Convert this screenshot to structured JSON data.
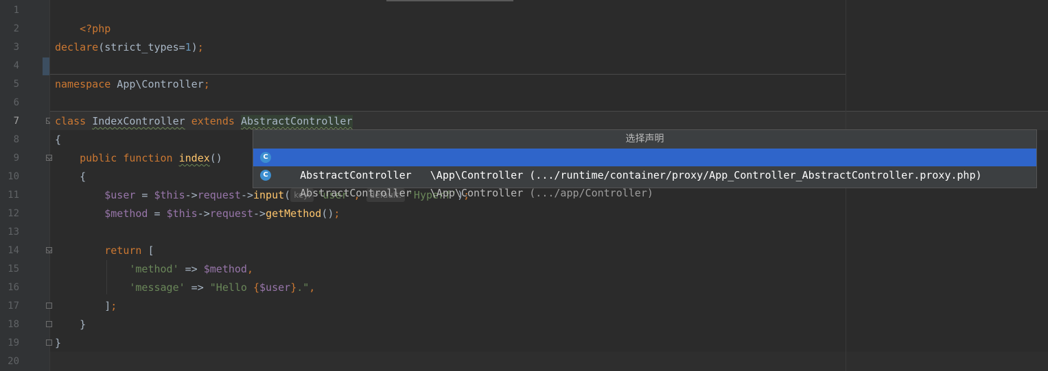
{
  "gutter": {
    "line_numbers": [
      "1",
      "2",
      "3",
      "4",
      "5",
      "6",
      "7",
      "8",
      "9",
      "10",
      "11",
      "12",
      "13",
      "14",
      "15",
      "16",
      "17",
      "18",
      "19",
      "20"
    ]
  },
  "code": {
    "l1": {
      "open_tag": "<?php"
    },
    "l3": {
      "declare": "declare",
      "paren_open": "(",
      "arg": "strict_types=",
      "value": "1",
      "paren_close": ")",
      "semi": ";"
    },
    "l5": {
      "namespace_kw": "namespace",
      "name": " App\\Controller",
      "semi": ";"
    },
    "l7": {
      "class_kw": "class",
      "class_name": "IndexController",
      "extends_kw": "extends",
      "parent": "AbstractController"
    },
    "l8": {
      "brace": "{"
    },
    "l9": {
      "public_kw": "public",
      "function_kw": "function",
      "fn_name": "index",
      "parens": "()"
    },
    "l10": {
      "brace": "{"
    },
    "l11": {
      "var": "$user",
      "assign": " = ",
      "this": "$this",
      "arrow1": "->",
      "prop": "request",
      "arrow2": "->",
      "method": "input",
      "paren": "(",
      "hint_key": "key:",
      "arg1": "'user'",
      "comma": ", ",
      "hint_default": "default:",
      "arg2": "'Hyperf'",
      "close": ")",
      "semi": ";"
    },
    "l12": {
      "var": "$method",
      "assign": " = ",
      "this": "$this",
      "arrow1": "->",
      "prop": "request",
      "arrow2": "->",
      "method": "getMethod",
      "call": "()",
      "semi": ";"
    },
    "l14": {
      "return_kw": "return",
      "bracket": " ["
    },
    "l15": {
      "key": "'method'",
      "arrow": " => ",
      "var": "$method",
      "comma": ","
    },
    "l16": {
      "key": "'message'",
      "arrow": " => ",
      "str_open": "\"Hello ",
      "interp_open": "{",
      "interp_var": "$user",
      "interp_close": "}",
      "str_close": ".\"",
      "comma": ","
    },
    "l17": {
      "bracket": "]",
      "semi": ";"
    },
    "l18": {
      "brace": "}"
    },
    "l19": {
      "brace": "}"
    }
  },
  "popup": {
    "title": "选择声明",
    "items": [
      {
        "icon": "C",
        "name": "AbstractController",
        "namespace": "\\App\\Controller",
        "path": "(.../runtime/container/proxy/App_Controller_AbstractController.proxy.php)",
        "selected": true
      },
      {
        "icon": "C",
        "name": "AbstractController",
        "namespace": "\\App\\Controller",
        "path": "(.../app/Controller)",
        "selected": false
      }
    ]
  },
  "colors": {
    "background": "#2b2b2b",
    "keyword": "#cc7832",
    "string": "#6a8759",
    "variable": "#9876aa",
    "function": "#ffc66d",
    "number": "#6897bb",
    "selection": "#2f65ca"
  }
}
